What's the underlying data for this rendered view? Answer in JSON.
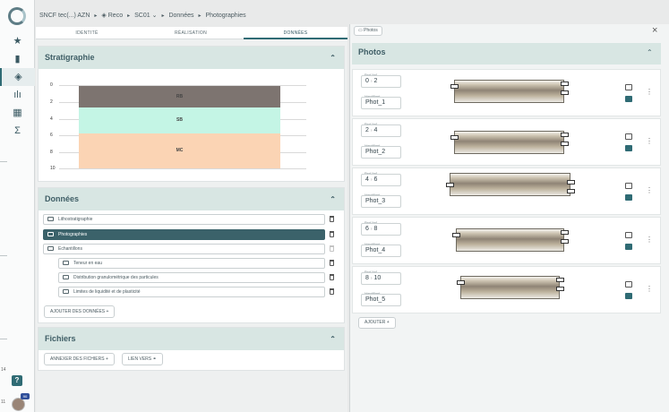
{
  "breadcrumb": {
    "items": [
      "SNCF tec(...) AZN",
      "Reco",
      "SC01",
      "Données",
      "Photographies"
    ]
  },
  "tabs": [
    "IDENTITÉ",
    "RÉALISATION",
    "DONNÉES"
  ],
  "stratigraphie": {
    "title": "Stratigraphie",
    "y_ticks": [
      "0",
      "2",
      "4",
      "6",
      "8",
      "10"
    ],
    "layers": [
      {
        "label": "RB",
        "color": "#7d7470"
      },
      {
        "label": "SB",
        "color": "#c4f5e5"
      },
      {
        "label": "MC",
        "color": "#fbd4b4"
      }
    ]
  },
  "donnees": {
    "title": "Données",
    "items": [
      {
        "label": "Lithostratigraphie",
        "selected": false
      },
      {
        "label": "Photographies",
        "selected": true
      },
      {
        "label": "Echantillons",
        "selected": false
      },
      {
        "label": "Teneur en eau",
        "selected": false
      },
      {
        "label": "Distribution granulométrique des particules",
        "selected": false
      },
      {
        "label": "Limites de liquidité et de plasticité",
        "selected": false
      }
    ],
    "add_label": "AJOUTER DES DONNÉES"
  },
  "fichiers": {
    "title": "Fichiers",
    "attach_label": "ANNEXER DES FICHIERS",
    "link_label": "LIEN VERS"
  },
  "right": {
    "tag": "Photos",
    "close": "×",
    "title": "Photos",
    "prof_label": "Prof.[m]",
    "ident_label": "Identifiant",
    "rows": [
      {
        "from": "0",
        "to": "2",
        "id": "Phot_1"
      },
      {
        "from": "2",
        "to": "4",
        "id": "Phot_2"
      },
      {
        "from": "4",
        "to": "6",
        "id": "Phot_3"
      },
      {
        "from": "6",
        "to": "8",
        "id": "Phot_4"
      },
      {
        "from": "8",
        "to": "10",
        "id": "Phot_5"
      }
    ],
    "add_label": "AJOUTER"
  },
  "side": {
    "numbers": [
      "14",
      "11"
    ],
    "badge": "90",
    "help": "?"
  }
}
